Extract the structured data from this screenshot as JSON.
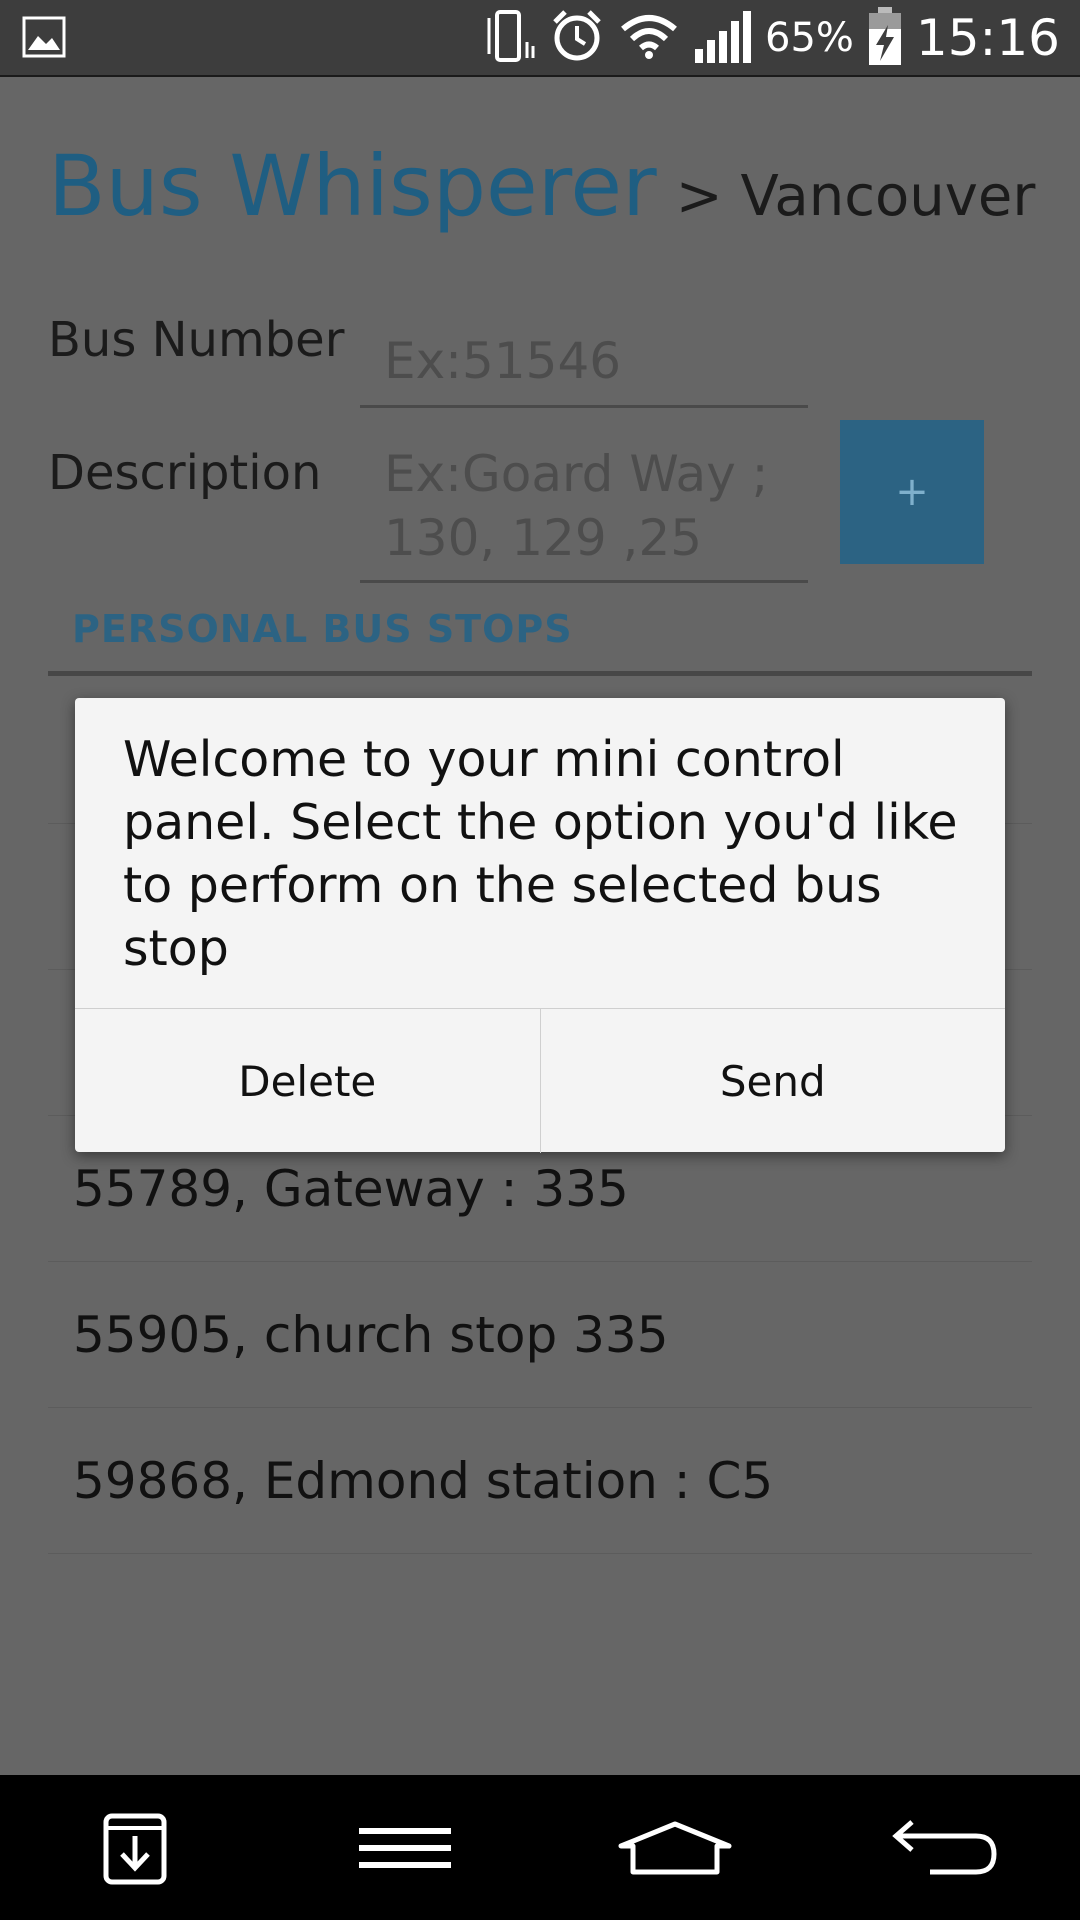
{
  "status_bar": {
    "battery_percent": "65%",
    "time": "15:16",
    "icons": [
      "gallery-icon",
      "vibrate-icon",
      "alarm-icon",
      "wifi-icon",
      "signal-icon",
      "battery-charging-icon"
    ]
  },
  "header": {
    "app_title": "Bus Whisperer",
    "city": "> Vancouver"
  },
  "form": {
    "bus_number_label": "Bus Number",
    "bus_number_placeholder": "Ex:51546",
    "description_label": "Description",
    "description_placeholder": "Ex:Goard Way ; 130, 129 ,25",
    "add_button_label": "+"
  },
  "stops": {
    "section_title": "PERSONAL BUS STOPS",
    "items": [
      {
        "label": ""
      },
      {
        "label": ""
      },
      {
        "label": ""
      },
      {
        "label": "55789, Gateway : 335"
      },
      {
        "label": "55905, church stop 335"
      },
      {
        "label": "59868, Edmond station : C5"
      }
    ]
  },
  "dialog": {
    "message": "Welcome to your mini control panel. Select the option you'd like to perform on the selected bus stop",
    "delete_label": "Delete",
    "send_label": "Send"
  },
  "nav_bar": {
    "icons": [
      "download-icon",
      "menu-icon",
      "home-icon",
      "back-icon"
    ]
  },
  "colors": {
    "accent": "#2c6383",
    "overlay": "#666666",
    "dialog_bg": "#f4f4f4"
  }
}
